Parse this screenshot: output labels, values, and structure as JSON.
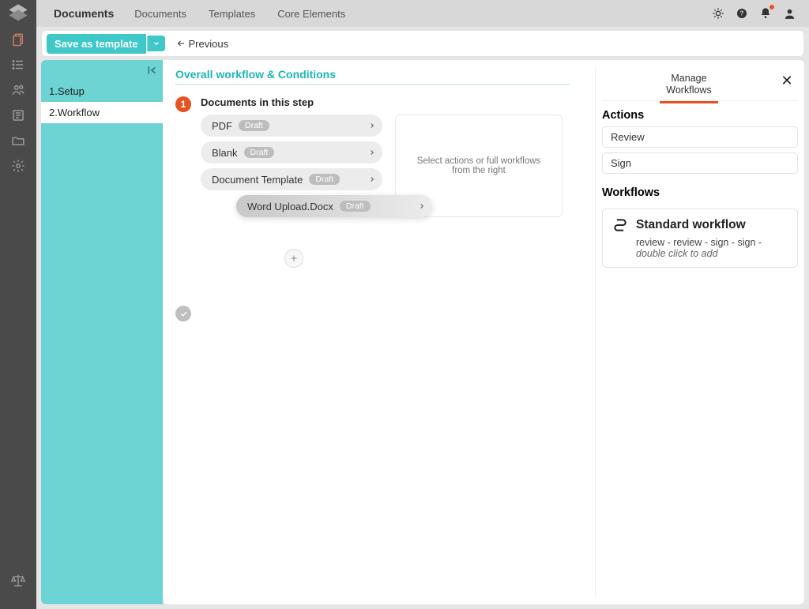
{
  "topbar": {
    "brand": "Documents",
    "nav": [
      "Documents",
      "Templates",
      "Core Elements"
    ]
  },
  "toolbar": {
    "save_label": "Save as template",
    "previous_label": "Previous"
  },
  "steps_sidebar": {
    "items": [
      {
        "label": "1.Setup"
      },
      {
        "label": "2.Workflow"
      }
    ],
    "active_index": 1
  },
  "workflow": {
    "section_title": "Overall workflow & Conditions",
    "step_number": "1",
    "step_heading": "Documents in this step",
    "documents": [
      {
        "name": "PDF",
        "status": "Draft",
        "dragging": false
      },
      {
        "name": "Blank",
        "status": "Draft",
        "dragging": false
      },
      {
        "name": "Document Template",
        "status": "Draft",
        "dragging": false
      },
      {
        "name": "Word Upload.Docx",
        "status": "Draft",
        "dragging": true
      }
    ],
    "actions_placeholder": "Select actions or full workflows from the right"
  },
  "right_panel": {
    "tab_line1": "Manage",
    "tab_line2": "Workflows",
    "actions_heading": "Actions",
    "actions": [
      "Review",
      "Sign"
    ],
    "workflows_heading": "Workflows",
    "standard_workflow": {
      "title": "Standard workflow",
      "sequence": "review -   review -   sign -   sign -",
      "hint": "double click to add"
    }
  }
}
